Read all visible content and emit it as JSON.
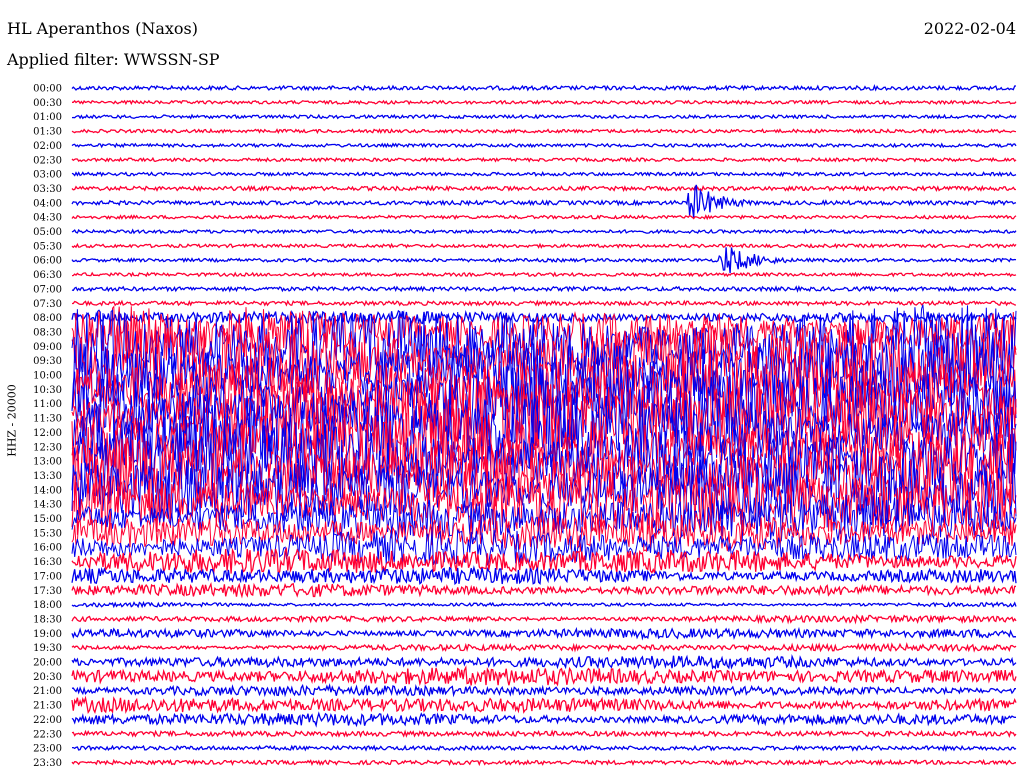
{
  "header": {
    "station": "HL Aperanthos (Naxos)",
    "date": "2022-02-04",
    "filter": "Applied filter: WWSSN-SP",
    "channel_label": "HHZ - 20000"
  },
  "colors": {
    "even_row": "#0000ee",
    "odd_row": "#ff0033"
  },
  "chart_data": {
    "type": "line",
    "title": "HL Aperanthos (Naxos)",
    "subtitle": "Applied filter: WWSSN-SP",
    "ylabel": "HHZ - 20000",
    "row_labels": [
      "00:00",
      "00:30",
      "01:00",
      "01:30",
      "02:00",
      "02:30",
      "03:00",
      "03:30",
      "04:00",
      "04:30",
      "05:00",
      "05:30",
      "06:00",
      "06:30",
      "07:00",
      "07:30",
      "08:00",
      "08:30",
      "09:00",
      "09:30",
      "10:00",
      "10:30",
      "11:00",
      "11:30",
      "12:00",
      "12:30",
      "13:00",
      "13:30",
      "14:00",
      "14:30",
      "15:00",
      "15:30",
      "16:00",
      "16:30",
      "17:00",
      "17:30",
      "18:00",
      "18:30",
      "19:00",
      "19:30",
      "20:00",
      "20:30",
      "21:00",
      "21:30",
      "22:00",
      "22:30",
      "23:00",
      "23:30"
    ],
    "row_minutes": 30,
    "amplitude_level": [
      0.02,
      0.01,
      0.01,
      0.01,
      0.01,
      0.01,
      0.01,
      0.02,
      0.02,
      0.01,
      0.01,
      0.01,
      0.01,
      0.01,
      0.02,
      0.02,
      0.15,
      0.6,
      1.0,
      1.0,
      1.0,
      1.0,
      1.0,
      1.0,
      1.0,
      1.0,
      1.0,
      0.95,
      0.9,
      0.85,
      0.55,
      0.45,
      0.4,
      0.3,
      0.2,
      0.15,
      0.05,
      0.08,
      0.12,
      0.08,
      0.14,
      0.2,
      0.12,
      0.18,
      0.15,
      0.03,
      0.02,
      0.02
    ],
    "events": [
      {
        "row": "04:00",
        "minute": 19.5,
        "amplitude": 0.6,
        "duration_min": 2.5
      },
      {
        "row": "06:00",
        "minute": 20.5,
        "amplitude": 0.45,
        "duration_min": 3
      }
    ],
    "legend": "none",
    "grid": false
  }
}
